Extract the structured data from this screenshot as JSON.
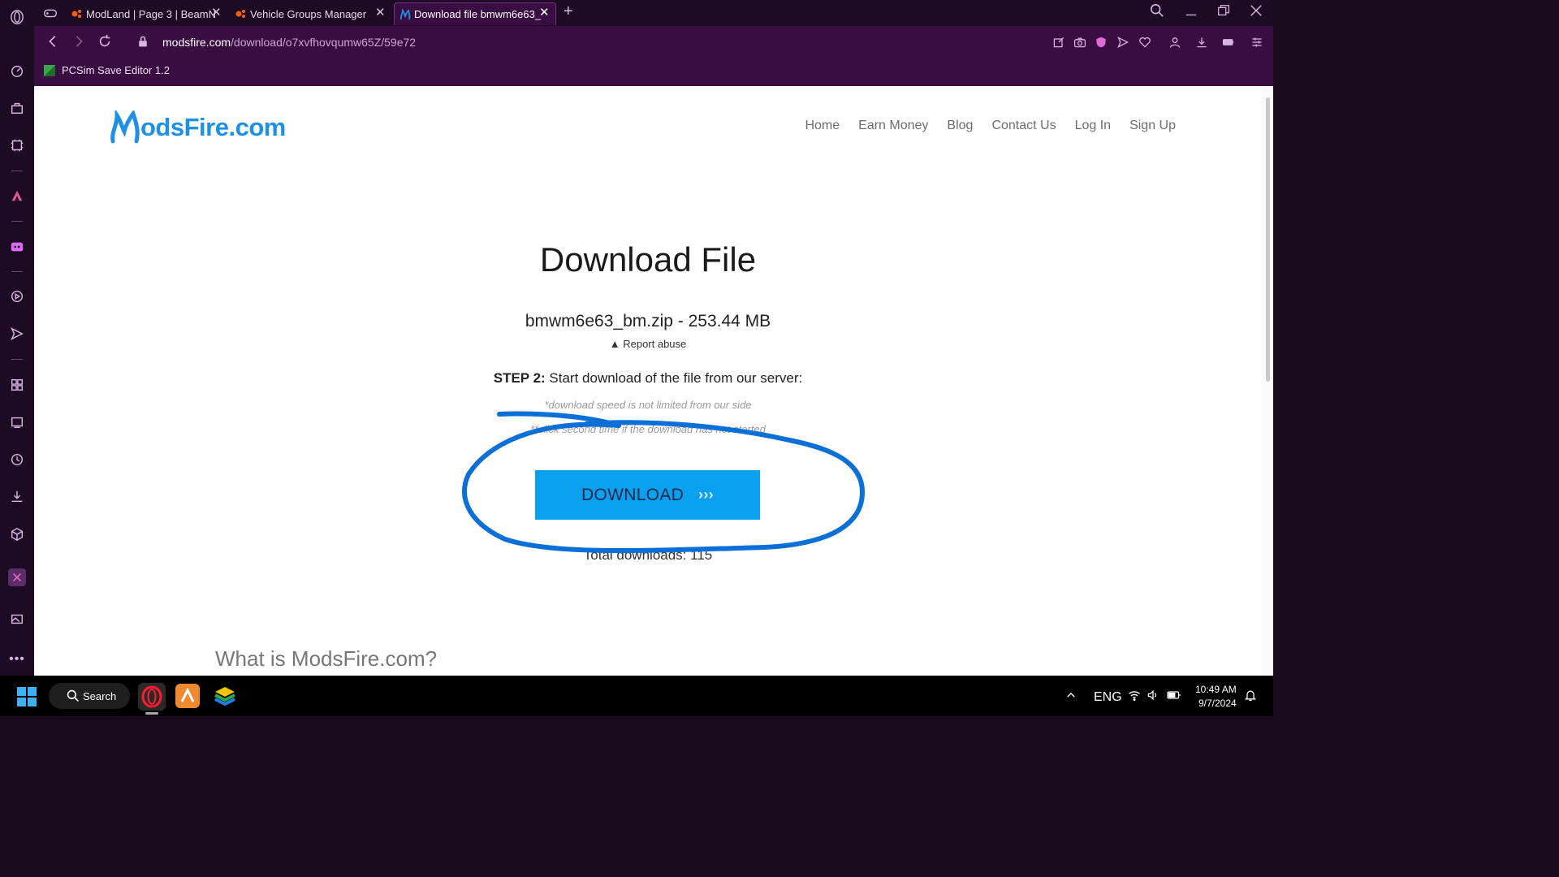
{
  "browser": {
    "tabs": [
      {
        "label": "ModLand | Page 3 | BeamN"
      },
      {
        "label": "Vehicle Groups Manager"
      },
      {
        "label": "Download file bmwm6e63_"
      }
    ],
    "new_tab": "+",
    "url_host": "modsfire.com",
    "url_path": "/download/o7xvfhovqumw65Z/59e72",
    "bookmark": "PCSim Save Editor 1.2"
  },
  "site": {
    "logo": "odsFire.com",
    "nav": [
      "Home",
      "Earn Money",
      "Blog",
      "Contact Us",
      "Log In",
      "Sign Up"
    ],
    "title": "Download File",
    "filename": "bmwm6e63_bm.zip - 253.44 MB",
    "report": "Report abuse",
    "step_label": "STEP 2:",
    "step_text": " Start download of the file from our server:",
    "note1": "*download speed is not limited from our side",
    "note2": "**click second time if the download has not started",
    "download_label": "DOWNLOAD",
    "download_arrows": "›››",
    "total": "Total downloads: 115",
    "about": "What is ModsFire.com?"
  },
  "taskbar": {
    "search": "Search",
    "lang": "ENG",
    "time": "10:49 AM",
    "date": "9/7/2024"
  },
  "colors": {
    "accent": "#0aa0f0",
    "brand": "#1e90e8",
    "browser_bg": "#3a0d42",
    "annotation": "#0a6fd6"
  }
}
